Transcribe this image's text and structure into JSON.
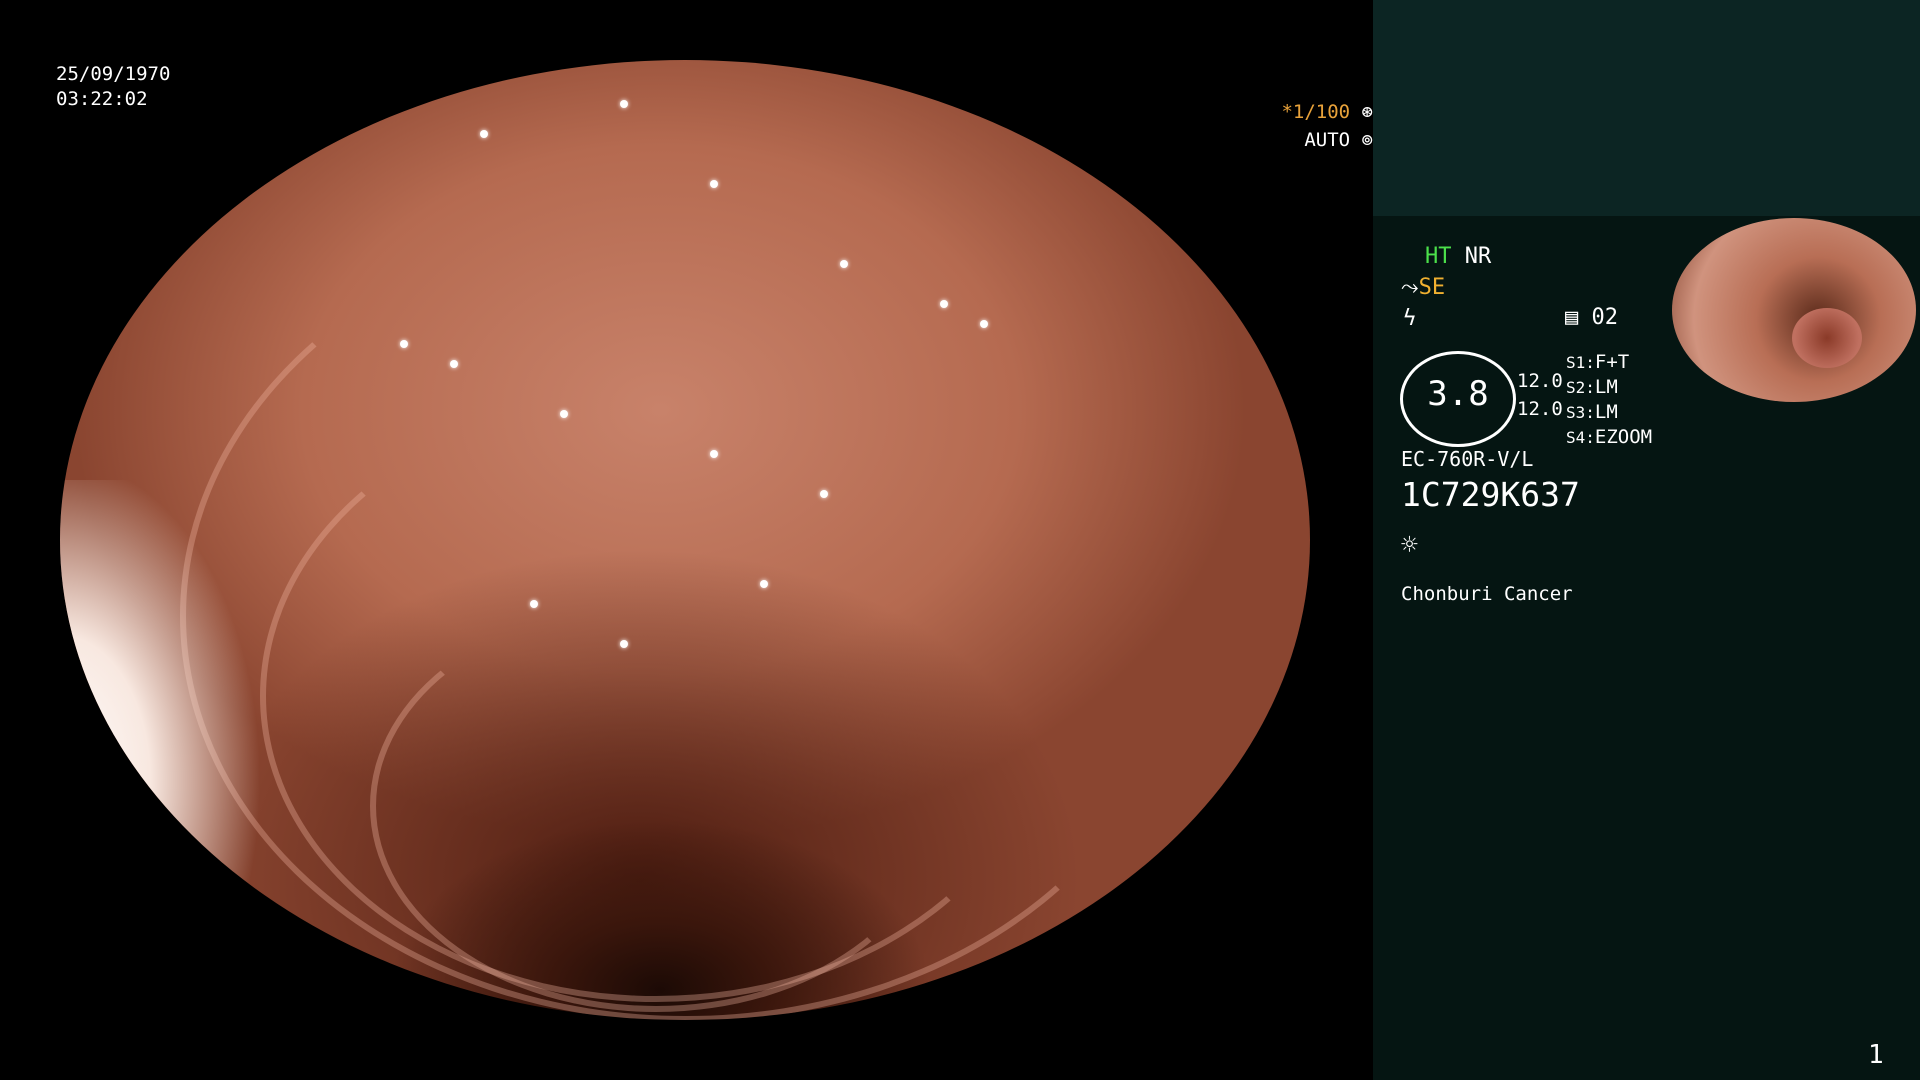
{
  "overlay": {
    "date": "25/09/1970",
    "time": "03:22:02",
    "shutter": "*1/100",
    "shutter_icon": "aperture-icon",
    "iris": "AUTO",
    "iris_icon": "iris-icon"
  },
  "panel": {
    "ht": "HT",
    "nr": "NR",
    "se": "SE",
    "counter": "02",
    "zoom_value": "3.8",
    "val1": "12.0",
    "val2": "12.0",
    "switches": [
      {
        "key": "S1:",
        "value": "F+T"
      },
      {
        "key": "S2:",
        "value": "LM"
      },
      {
        "key": "S3:",
        "value": "LM"
      },
      {
        "key": "S4:",
        "value": "EZOOM"
      }
    ],
    "model": "EC-760R-V/L",
    "serial": "1C729K637",
    "hospital": "Chonburi Cancer",
    "page_number": "1"
  },
  "colors": {
    "ht": "#4be04b",
    "se": "#f0b030",
    "panel_bg": "#051512",
    "panel_top": "#0c2523"
  }
}
